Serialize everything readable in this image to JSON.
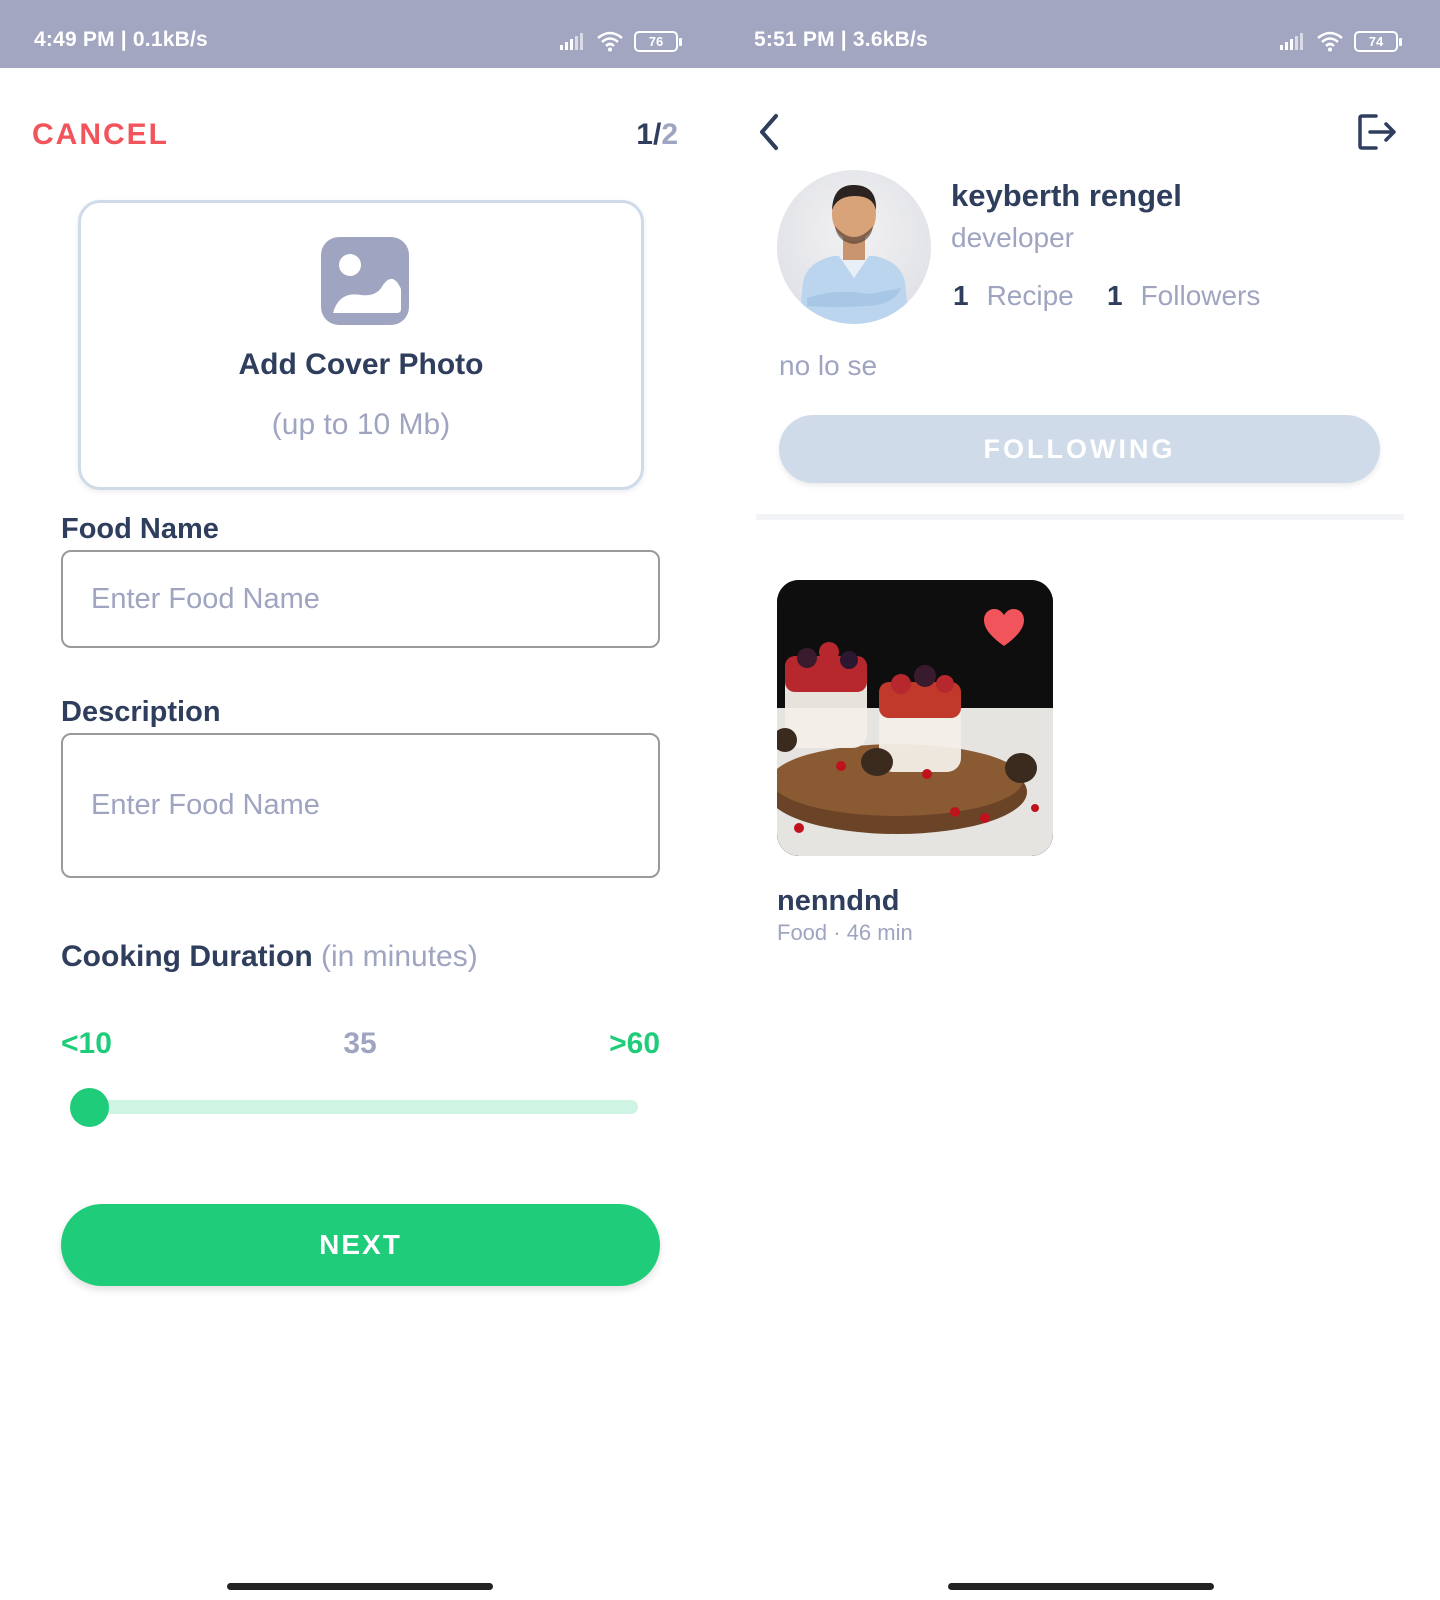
{
  "left_screen": {
    "status_bar": {
      "text": "4:49 PM | 0.1kB/s",
      "battery": "76"
    },
    "header": {
      "cancel_label": "CANCEL",
      "step_current": "1/",
      "step_total": "2"
    },
    "cover": {
      "title": "Add Cover Photo",
      "subtitle": "(up to 10 Mb)",
      "icon": "image-icon"
    },
    "food_name": {
      "label": "Food Name",
      "placeholder": "Enter Food Name",
      "value": ""
    },
    "description": {
      "label": "Description",
      "placeholder": "Enter Food Name",
      "value": ""
    },
    "duration": {
      "label": "Cooking Duration",
      "unit": "(in minutes)",
      "min_label": "<10",
      "current_label": "35",
      "max_label": ">60",
      "slider_fraction": 0
    },
    "next_label": "NEXT"
  },
  "right_screen": {
    "status_bar": {
      "text": "5:51 PM | 3.6kB/s",
      "battery": "74"
    },
    "profile": {
      "name": "keyberth rengel",
      "role": "developer",
      "recipes_count": "1",
      "recipes_label": "Recipe",
      "followers_count": "1",
      "followers_label": "Followers",
      "bio": "no lo se",
      "follow_button_label": "FOLLOWING"
    },
    "recipes": [
      {
        "title": "nenndnd",
        "meta": "Food · 46 min",
        "liked": true
      }
    ]
  },
  "colors": {
    "primary": "#1fcc79",
    "danger": "#f2545b",
    "heading": "#2e3e5c",
    "muted": "#9fa5c0",
    "outline": "#d0dbea",
    "status_bar": "#a2a6c0"
  }
}
